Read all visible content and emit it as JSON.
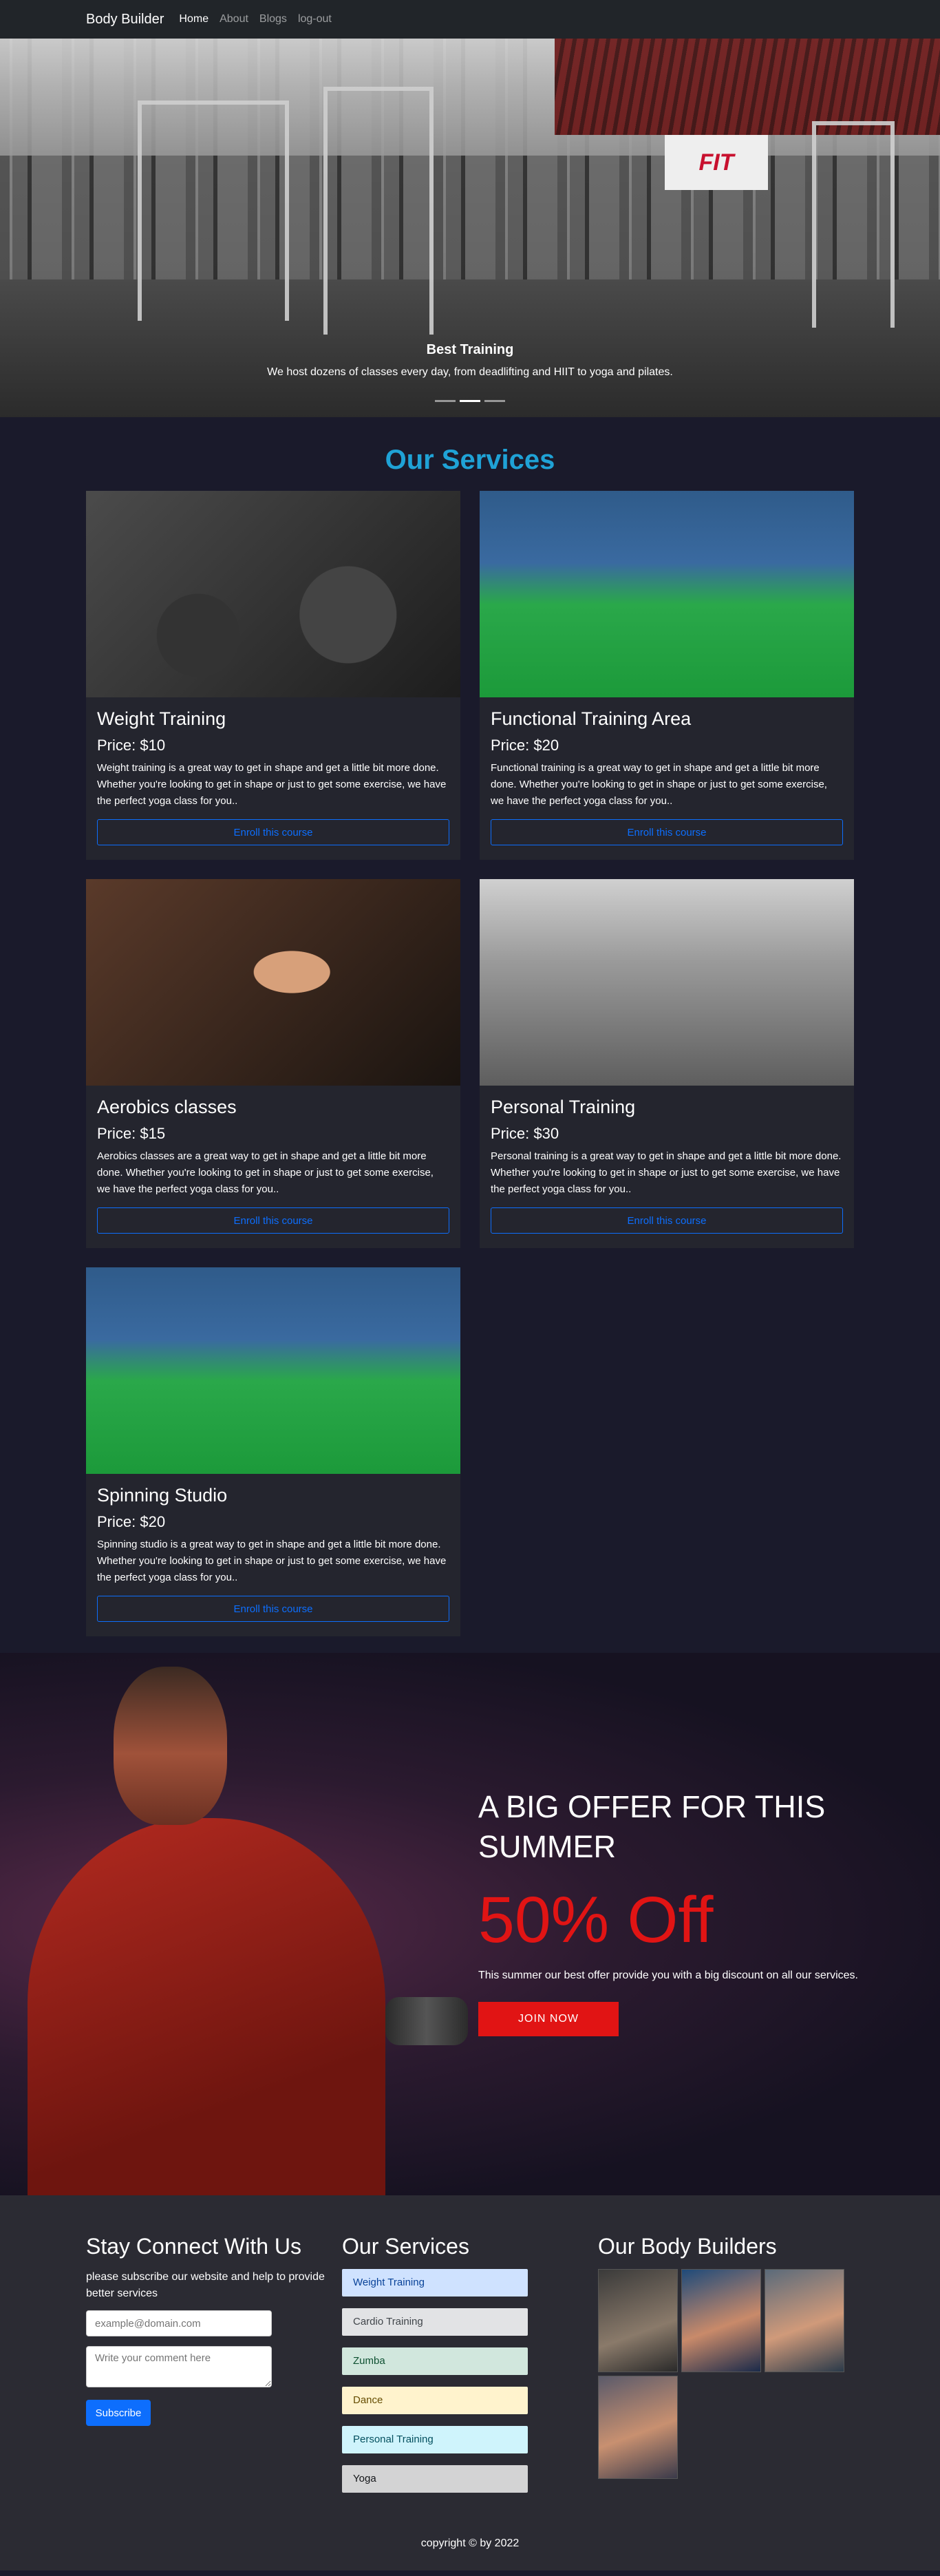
{
  "nav": {
    "brand": "Body Builder",
    "links": [
      "Home",
      "About",
      "Blogs",
      "log-out"
    ]
  },
  "hero": {
    "title": "Best Training",
    "subtitle": "We host dozens of classes every day, from deadlifting and HIIT to yoga and pilates.",
    "sign_text": "FIT",
    "slides": 3,
    "active_slide": 1
  },
  "services": {
    "heading": "Our Services",
    "enroll_label": "Enroll this course",
    "items": [
      {
        "title": "Weight Training",
        "price": "Price: $10",
        "text": "Weight training is a great way to get in shape and get a little bit more done. Whether you're looking to get in shape or just to get some exercise, we have the perfect yoga class for you.."
      },
      {
        "title": "Functional Training Area",
        "price": "Price: $20",
        "text": "Functional training is a great way to get in shape and get a little bit more done. Whether you're looking to get in shape or just to get some exercise, we have the perfect yoga class for you.."
      },
      {
        "title": "Aerobics classes",
        "price": "Price: $15",
        "text": "Aerobics classes are a great way to get in shape and get a little bit more done. Whether you're looking to get in shape or just to get some exercise, we have the perfect yoga class for you.."
      },
      {
        "title": "Personal Training",
        "price": "Price: $30",
        "text": "Personal training is a great way to get in shape and get a little bit more done. Whether you're looking to get in shape or just to get some exercise, we have the perfect yoga class for you.."
      },
      {
        "title": "Spinning Studio",
        "price": "Price: $20",
        "text": "Spinning studio is a great way to get in shape and get a little bit more done. Whether you're looking to get in shape or just to get some exercise, we have the perfect yoga class for you.."
      }
    ]
  },
  "offer": {
    "heading": "A BIG OFFER FOR THIS SUMMER",
    "discount": "50% Off",
    "text": "This summer our best offer provide you with a big discount on all our services.",
    "button": "JOIN NOW",
    "accent": "#e11414"
  },
  "footer": {
    "connect": {
      "heading": "Stay Connect With Us",
      "intro": "please subscribe our website and help to provide better services",
      "email_placeholder": "example@domain.com",
      "comment_placeholder": "Write your comment here",
      "subscribe_label": "Subscribe"
    },
    "services": {
      "heading": "Our Services",
      "items": [
        {
          "label": "Weight Training",
          "bg": "#cfe2ff",
          "color": "#084298"
        },
        {
          "label": "Cardio Training",
          "bg": "#e2e3e5",
          "color": "#41464b"
        },
        {
          "label": "Zumba",
          "bg": "#d1e7dd",
          "color": "#0f5132"
        },
        {
          "label": "Dance",
          "bg": "#fff3cd",
          "color": "#664d03"
        },
        {
          "label": "Personal Training",
          "bg": "#cff4fc",
          "color": "#055160"
        },
        {
          "label": "Yoga",
          "bg": "#d3d3d4",
          "color": "#141619"
        }
      ]
    },
    "builders": {
      "heading": "Our Body Builders",
      "count": 4
    },
    "copyright": "copyright © by 2022"
  },
  "colors": {
    "page_bg": "#1a1a2b",
    "services_heading": "#1fa2d6",
    "primary": "#0d6efd"
  }
}
